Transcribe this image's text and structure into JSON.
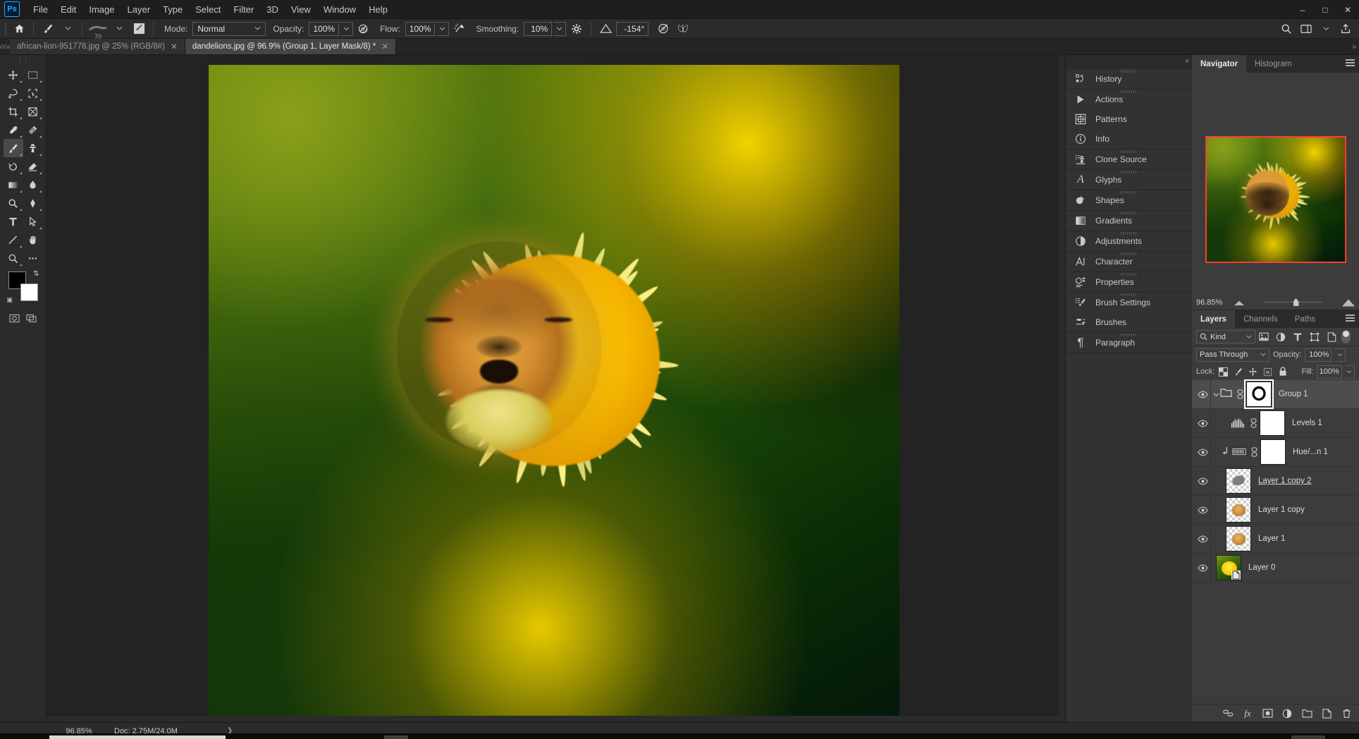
{
  "app": {
    "name": "Adobe Photoshop",
    "logo_text": "Ps"
  },
  "menubar": {
    "items": [
      "File",
      "Edit",
      "Image",
      "Layer",
      "Type",
      "Select",
      "Filter",
      "3D",
      "View",
      "Window",
      "Help"
    ],
    "window_controls": {
      "minimize": "–",
      "maximize": "□",
      "close": "✕"
    }
  },
  "options_bar": {
    "home_icon": "home-icon",
    "tool_icon": "brush-tool-icon",
    "brush_preset_size": "70",
    "mode_label": "Mode:",
    "mode_value": "Normal",
    "opacity_label": "Opacity:",
    "opacity_value": "100%",
    "pressure_opacity_icon": "pressure-opacity-icon",
    "flow_label": "Flow:",
    "flow_value": "100%",
    "airbrush_icon": "airbrush-icon",
    "smoothing_label": "Smoothing:",
    "smoothing_value": "10%",
    "smoothing_options_icon": "gear-icon",
    "angle_icon": "angle-icon",
    "angle_value": "-154°",
    "pressure_size_icon": "pressure-size-icon",
    "symmetry_icon": "butterfly-symmetry-icon"
  },
  "tabs": [
    {
      "label": "african-lion-951778.jpg @ 25% (RGB/8#)",
      "active": false,
      "modified": false
    },
    {
      "label": "dandelions.jpg @ 96.9% (Group 1, Layer Mask/8) *",
      "active": true,
      "modified": true
    }
  ],
  "toolbar": {
    "tools": [
      {
        "name": "move-tool",
        "glyph": "✥"
      },
      {
        "name": "rectangular-marquee-tool",
        "glyph": "⬚"
      },
      {
        "name": "lasso-tool",
        "glyph": "⊃"
      },
      {
        "name": "object-selection-tool",
        "glyph": "✒"
      },
      {
        "name": "crop-tool",
        "glyph": "⌗"
      },
      {
        "name": "frame-tool",
        "glyph": "⧉"
      },
      {
        "name": "eyedropper-tool",
        "glyph": "⚗"
      },
      {
        "name": "spot-healing-brush-tool",
        "glyph": "⚕"
      },
      {
        "name": "brush-tool",
        "glyph": "✎",
        "active": true
      },
      {
        "name": "clone-stamp-tool",
        "glyph": "⚑"
      },
      {
        "name": "history-brush-tool",
        "glyph": "⟳"
      },
      {
        "name": "eraser-tool",
        "glyph": "▱"
      },
      {
        "name": "gradient-tool",
        "glyph": "▤"
      },
      {
        "name": "blur-tool",
        "glyph": "●"
      },
      {
        "name": "dodge-tool",
        "glyph": "◔"
      },
      {
        "name": "pen-tool",
        "glyph": "✒"
      },
      {
        "name": "type-tool",
        "glyph": "T"
      },
      {
        "name": "path-selection-tool",
        "glyph": "➤"
      },
      {
        "name": "line-tool",
        "glyph": "╱"
      },
      {
        "name": "hand-tool",
        "glyph": "✋"
      },
      {
        "name": "zoom-tool",
        "glyph": "⚲"
      },
      {
        "name": "edit-toolbar-tool",
        "glyph": "⋯"
      }
    ],
    "foreground_color": "#000000",
    "background_color": "#ffffff",
    "quickmask_icon": "quick-mask-icon",
    "screenmode_icon": "screen-mode-icon"
  },
  "panel_rail": {
    "groups": [
      {
        "items": [
          {
            "label": "History",
            "icon": "history-icon"
          }
        ]
      },
      {
        "items": [
          {
            "label": "Actions",
            "icon": "actions-play-icon"
          },
          {
            "label": "Patterns",
            "icon": "patterns-icon"
          },
          {
            "label": "Info",
            "icon": "info-icon"
          }
        ]
      },
      {
        "items": [
          {
            "label": "Clone Source",
            "icon": "clone-source-icon"
          }
        ]
      },
      {
        "items": [
          {
            "label": "Glyphs",
            "icon": "glyphs-icon"
          }
        ]
      },
      {
        "items": [
          {
            "label": "Shapes",
            "icon": "shapes-icon"
          }
        ]
      },
      {
        "items": [
          {
            "label": "Gradients",
            "icon": "gradients-icon"
          }
        ]
      },
      {
        "items": [
          {
            "label": "Adjustments",
            "icon": "adjustments-icon"
          }
        ]
      },
      {
        "items": [
          {
            "label": "Character",
            "icon": "character-icon"
          }
        ]
      },
      {
        "items": [
          {
            "label": "Properties",
            "icon": "properties-icon"
          }
        ]
      },
      {
        "items": [
          {
            "label": "Brush Settings",
            "icon": "brush-settings-icon"
          },
          {
            "label": "Brushes",
            "icon": "brushes-icon"
          }
        ]
      },
      {
        "items": [
          {
            "label": "Paragraph",
            "icon": "paragraph-icon"
          }
        ]
      }
    ]
  },
  "navigator": {
    "tabs": [
      {
        "label": "Navigator",
        "active": true
      },
      {
        "label": "Histogram",
        "active": false
      }
    ],
    "zoom_value": "96.85%",
    "menu_icon": "panel-menu-icon",
    "zoom_out_icon": "zoom-out-mountain-icon",
    "zoom_in_icon": "zoom-in-mountain-icon"
  },
  "layers_panel": {
    "tabs": [
      {
        "label": "Layers",
        "active": true
      },
      {
        "label": "Channels",
        "active": false
      },
      {
        "label": "Paths",
        "active": false
      }
    ],
    "menu_icon": "panel-menu-icon",
    "filter": {
      "search_icon": "search-icon",
      "kind_label": "Kind",
      "chevron": "⌄",
      "icons": [
        "pixel-filter-icon",
        "adjustment-filter-icon",
        "type-filter-icon",
        "shape-filter-icon",
        "smartobject-filter-icon"
      ],
      "toggle": "filter-enable-toggle"
    },
    "blend_mode": "Pass Through",
    "opacity_label": "Opacity:",
    "opacity_value": "100%",
    "lock_label": "Lock:",
    "lock_icons": [
      "lock-transparency-icon",
      "lock-image-icon",
      "lock-position-icon",
      "lock-artboard-icon",
      "lock-all-icon"
    ],
    "fill_label": "Fill:",
    "fill_value": "100%",
    "layers": [
      {
        "name": "Group 1",
        "type": "group",
        "selected": true,
        "expanded": true,
        "visible": true,
        "has_mask": true,
        "mask_selected": true,
        "linked": true
      },
      {
        "name": "Levels 1",
        "type": "adjustment-levels",
        "selected": false,
        "visible": true,
        "has_mask": true,
        "linked": true
      },
      {
        "name": "Hue/...n 1",
        "type": "adjustment-hue-saturation",
        "selected": false,
        "visible": true,
        "has_mask": true,
        "linked": true,
        "clipped": true
      },
      {
        "name": "Layer 1 copy 2",
        "type": "pixel",
        "selected": false,
        "visible": true,
        "editing": true
      },
      {
        "name": "Layer 1 copy",
        "type": "pixel",
        "selected": false,
        "visible": true
      },
      {
        "name": "Layer 1",
        "type": "pixel",
        "selected": false,
        "visible": true
      },
      {
        "name": "Layer 0",
        "type": "smart-object",
        "selected": false,
        "visible": true
      }
    ],
    "footer_icons": [
      "link-layers-icon",
      "layer-style-icon",
      "add-mask-icon",
      "new-adjustment-layer-icon",
      "new-group-icon",
      "new-layer-icon",
      "delete-layer-icon"
    ],
    "footer_fx_label": "fx"
  },
  "status_bar": {
    "zoom": "96.85%",
    "doc_info": "Doc: 2.75M/24.0M",
    "expand_arrow": "❯"
  }
}
